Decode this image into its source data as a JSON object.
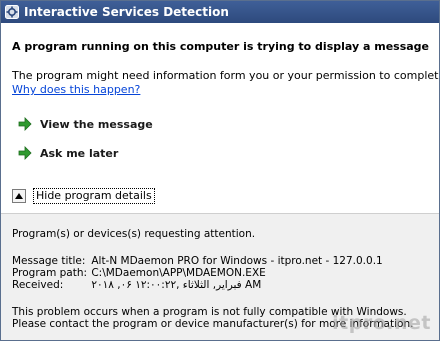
{
  "window": {
    "title": "Interactive Services Detection"
  },
  "main": {
    "headline": "A program running on this computer is trying to display a message",
    "description": "The program might need information form you or your permission to complete a task.",
    "why_link": "Why does this happen?",
    "commands": [
      {
        "label": "View the message",
        "icon": "green-arrow-icon"
      },
      {
        "label": "Ask me later",
        "icon": "green-arrow-icon"
      }
    ],
    "details_toggle": "Hide program details"
  },
  "details": {
    "requesting": "Program(s) or devices(s) requesting attention.",
    "message_title_key": "Message title:",
    "message_title_value": "Alt-N MDaemon PRO for Windows - itpro.net - 127.0.0.1",
    "program_path_key": "Program path:",
    "program_path_value": "C:\\MDaemon\\APP\\MDAEMON.EXE",
    "received_key": "Received:",
    "received_value": "۲۰۱۸ ,۰۶ فبراير, الثلاثاء ,۱۲:۰۰:۲۲ AM",
    "problem_text": "This problem occurs when a program is not fully compatible with Windows.",
    "contact_text": "Please contact the program or device manufacturer(s) for more information."
  },
  "watermark": "itpro.net",
  "colors": {
    "titlebar": "#2e4a7d",
    "link": "#0645d8",
    "arrow": "#2f9a2f",
    "details_bg": "#f0f0f0"
  }
}
